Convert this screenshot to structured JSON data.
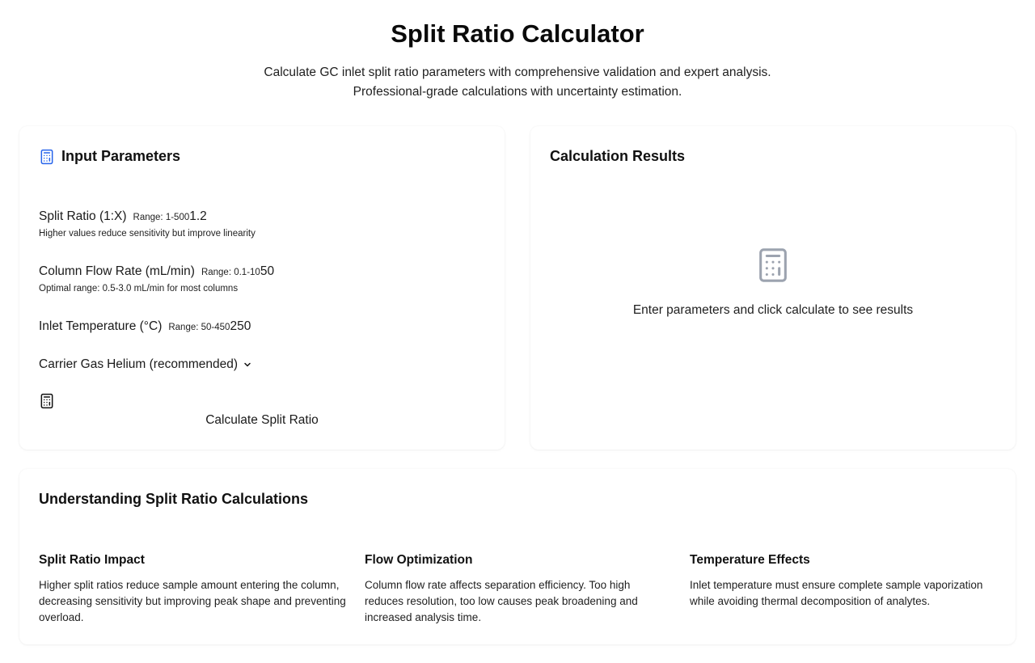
{
  "header": {
    "title": "Split Ratio Calculator",
    "subtitle_line1": "Calculate GC inlet split ratio parameters with comprehensive validation and expert analysis.",
    "subtitle_line2": "Professional-grade calculations with uncertainty estimation."
  },
  "inputs": {
    "heading": "Input Parameters",
    "heading_icon": "calculator-icon",
    "split_ratio": {
      "label": "Split Ratio (1:X)",
      "range": "Range: 1-500",
      "value": "1.2",
      "hint": "Higher values reduce sensitivity but improve linearity"
    },
    "column_flow": {
      "label": "Column Flow Rate (mL/min)",
      "range": "Range: 0.1-10",
      "value": "50",
      "hint": "Optimal range: 0.5-3.0 mL/min for most columns"
    },
    "inlet_temp": {
      "label": "Inlet Temperature (°C)",
      "range": "Range: 50-450",
      "value": "250"
    },
    "carrier_gas": {
      "label": "Carrier Gas",
      "selected": "Helium (recommended)",
      "icon": "chevron-down-icon"
    },
    "calculate_button": {
      "label": "Calculate Split Ratio",
      "icon": "calculator-icon"
    }
  },
  "results": {
    "heading": "Calculation Results",
    "empty_icon": "calculator-icon",
    "empty_text": "Enter parameters and click calculate to see results"
  },
  "info": {
    "heading": "Understanding Split Ratio Calculations",
    "columns": [
      {
        "title": "Split Ratio Impact",
        "body": "Higher split ratios reduce sample amount entering the column, decreasing sensitivity but improving peak shape and preventing overload."
      },
      {
        "title": "Flow Optimization",
        "body": "Column flow rate affects separation efficiency. Too high reduces resolution, too low causes peak broadening and increased analysis time."
      },
      {
        "title": "Temperature Effects",
        "body": "Inlet temperature must ensure complete sample vaporization while avoiding thermal decomposition of analytes."
      }
    ]
  },
  "colors": {
    "accent": "#2563eb",
    "text": "#111111",
    "muted_icon": "#9ca3af"
  }
}
